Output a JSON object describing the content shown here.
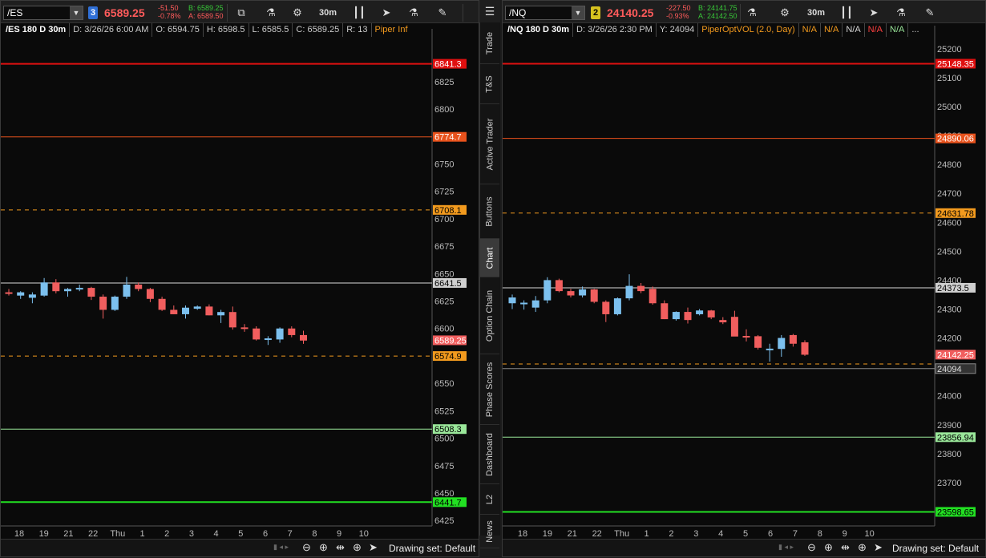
{
  "side_tabs": [
    "Trade",
    "T&S",
    "Active Trader",
    "Buttons",
    "Chart",
    "Option Chain",
    "Phase Scores",
    "Dashboard",
    "L2",
    "News"
  ],
  "side_active": "Chart",
  "menu_icon": "hamburger-menu-icon",
  "colors": {
    "up": "#7cc0ee",
    "down": "#f15e5e",
    "red_line": "#e01010",
    "orange_line": "#e8521c",
    "dash_orange": "#f29a1e",
    "white_line": "#d8d8d8",
    "light_green": "#9ae79a",
    "bright_green": "#22e022"
  },
  "left": {
    "symbol": "/ES",
    "link_number": "3",
    "last": "6589.25",
    "change": "-51.50",
    "change_pct": "-0.78%",
    "bid": "B: 6589.25",
    "ask": "A: 6589.50",
    "timeframe": "30m",
    "info": {
      "title": "/ES 180 D 30m",
      "date": "D: 3/26/26 6:00 AM",
      "open": "O: 6594.75",
      "high": "H: 6598.5",
      "low": "L: 6585.5",
      "close": "C: 6589.25",
      "range": "R: 13",
      "study_partial": "Piper Inf"
    },
    "drawing_set": "Drawing set: Default",
    "chart_data": {
      "type": "candlestick",
      "y_range": [
        6420,
        6860
      ],
      "y_ticks": [
        "6825",
        "6800",
        "6775",
        "6750",
        "6725",
        "6700",
        "6675",
        "6650",
        "6625",
        "6600",
        "6575",
        "6550",
        "6525",
        "6500",
        "6475",
        "6450",
        "6425"
      ],
      "x_ticks": [
        "18",
        "19",
        "21",
        "22",
        "Thu",
        "1",
        "2",
        "3",
        "4",
        "5",
        "6",
        "7",
        "8",
        "9",
        "10"
      ],
      "levels": [
        {
          "value": 6841.3,
          "label": "6841.3",
          "style": "red"
        },
        {
          "value": 6774.7,
          "label": "6774.7",
          "style": "orange"
        },
        {
          "value": 6708.1,
          "label": "6708.1",
          "style": "dash_orange"
        },
        {
          "value": 6641.5,
          "label": "6641.5",
          "style": "white"
        },
        {
          "value": 6589.25,
          "label": "6589.25",
          "style": "price"
        },
        {
          "value": 6574.9,
          "label": "6574.9",
          "style": "dash_orange"
        },
        {
          "value": 6508.3,
          "label": "6508.3",
          "style": "light_green"
        },
        {
          "value": 6441.7,
          "label": "6441.7",
          "style": "bright_green"
        }
      ],
      "candles": [
        [
          6633,
          6636,
          6630,
          6632
        ],
        [
          6630,
          6634,
          6627,
          6633
        ],
        [
          6628,
          6633,
          6623,
          6631
        ],
        [
          6630,
          6646,
          6629,
          6642
        ],
        [
          6642,
          6645,
          6632,
          6634
        ],
        [
          6634,
          6637,
          6629,
          6636
        ],
        [
          6636,
          6640,
          6634,
          6637
        ],
        [
          6637,
          6638,
          6626,
          6629
        ],
        [
          6629,
          6631,
          6609,
          6617
        ],
        [
          6617,
          6630,
          6616,
          6629
        ],
        [
          6629,
          6647,
          6627,
          6640
        ],
        [
          6640,
          6642,
          6634,
          6636
        ],
        [
          6636,
          6637,
          6624,
          6627
        ],
        [
          6627,
          6629,
          6616,
          6617
        ],
        [
          6617,
          6621,
          6613,
          6613
        ],
        [
          6613,
          6621,
          6609,
          6619
        ],
        [
          6618,
          6621,
          6617,
          6620
        ],
        [
          6620,
          6622,
          6612,
          6612
        ],
        [
          6612,
          6617,
          6605,
          6615
        ],
        [
          6615,
          6620,
          6599,
          6601
        ],
        [
          6601,
          6604,
          6597,
          6600
        ],
        [
          6600,
          6602,
          6589,
          6590
        ],
        [
          6590,
          6593,
          6585,
          6591
        ],
        [
          6590,
          6601,
          6587,
          6600
        ],
        [
          6600,
          6602,
          6592,
          6594
        ],
        [
          6594,
          6598,
          6586,
          6589
        ]
      ]
    }
  },
  "right": {
    "symbol": "/NQ",
    "link_number": "2",
    "last": "24140.25",
    "change": "-227.50",
    "change_pct": "-0.93%",
    "bid": "B: 24141.75",
    "ask": "A: 24142.50",
    "timeframe": "30m",
    "info": {
      "title": "/NQ 180 D 30m",
      "date": "D: 3/26/26 2:30 PM",
      "ylabel": "Y: 24094",
      "study": "PiperOptVOL (2.0, Day)",
      "na": [
        "N/A",
        "N/A",
        "N/A",
        "N/A",
        "N/A"
      ],
      "more": "..."
    },
    "drawing_set": "Drawing set: Default",
    "chart_data": {
      "type": "candlestick",
      "y_range": [
        23550,
        25230
      ],
      "y_ticks": [
        "25200",
        "25100",
        "25000",
        "24900",
        "24800",
        "24700",
        "24600",
        "24500",
        "24400",
        "24300",
        "24200",
        "24100",
        "24000",
        "23900",
        "23800",
        "23700",
        "23600"
      ],
      "x_ticks": [
        "18",
        "19",
        "21",
        "22",
        "Thu",
        "1",
        "2",
        "3",
        "4",
        "5",
        "6",
        "7",
        "8",
        "9",
        "10"
      ],
      "levels": [
        {
          "value": 25148.35,
          "label": "25148.35",
          "style": "red"
        },
        {
          "value": 24890.06,
          "label": "24890.06",
          "style": "orange"
        },
        {
          "value": 24631.78,
          "label": "24631.78",
          "style": "dash_orange"
        },
        {
          "value": 24373.5,
          "label": "24373.5",
          "style": "white"
        },
        {
          "value": 24142.25,
          "label": "24142.25",
          "style": "price"
        },
        {
          "value": 24110,
          "label": "",
          "style": "dash_orange_plain"
        },
        {
          "value": 24094,
          "label": "24094",
          "style": "crosshair"
        },
        {
          "value": 23856.94,
          "label": "23856.94",
          "style": "light_green"
        },
        {
          "value": 23598.65,
          "label": "23598.65",
          "style": "bright_green"
        }
      ],
      "candles": [
        [
          24320,
          24350,
          24300,
          24340
        ],
        [
          24318,
          24330,
          24298,
          24322
        ],
        [
          24305,
          24345,
          24290,
          24330
        ],
        [
          24330,
          24410,
          24320,
          24400
        ],
        [
          24400,
          24405,
          24358,
          24362
        ],
        [
          24362,
          24370,
          24340,
          24347
        ],
        [
          24347,
          24378,
          24340,
          24368
        ],
        [
          24368,
          24370,
          24320,
          24325
        ],
        [
          24325,
          24330,
          24255,
          24282
        ],
        [
          24282,
          24340,
          24278,
          24337
        ],
        [
          24337,
          24420,
          24330,
          24380
        ],
        [
          24380,
          24390,
          24355,
          24362
        ],
        [
          24370,
          24378,
          24315,
          24320
        ],
        [
          24320,
          24330,
          24265,
          24265
        ],
        [
          24265,
          24292,
          24260,
          24290
        ],
        [
          24290,
          24305,
          24250,
          24262
        ],
        [
          24282,
          24300,
          24278,
          24295
        ],
        [
          24295,
          24297,
          24265,
          24271
        ],
        [
          24262,
          24272,
          24248,
          24254
        ],
        [
          24273,
          24294,
          24208,
          24205
        ],
        [
          24207,
          24230,
          24188,
          24206
        ],
        [
          24206,
          24210,
          24160,
          24166
        ],
        [
          24162,
          24180,
          24118,
          24163
        ],
        [
          24162,
          24210,
          24135,
          24200
        ],
        [
          24210,
          24214,
          24170,
          24180
        ],
        [
          24185,
          24192,
          24138,
          24142
        ]
      ]
    }
  }
}
